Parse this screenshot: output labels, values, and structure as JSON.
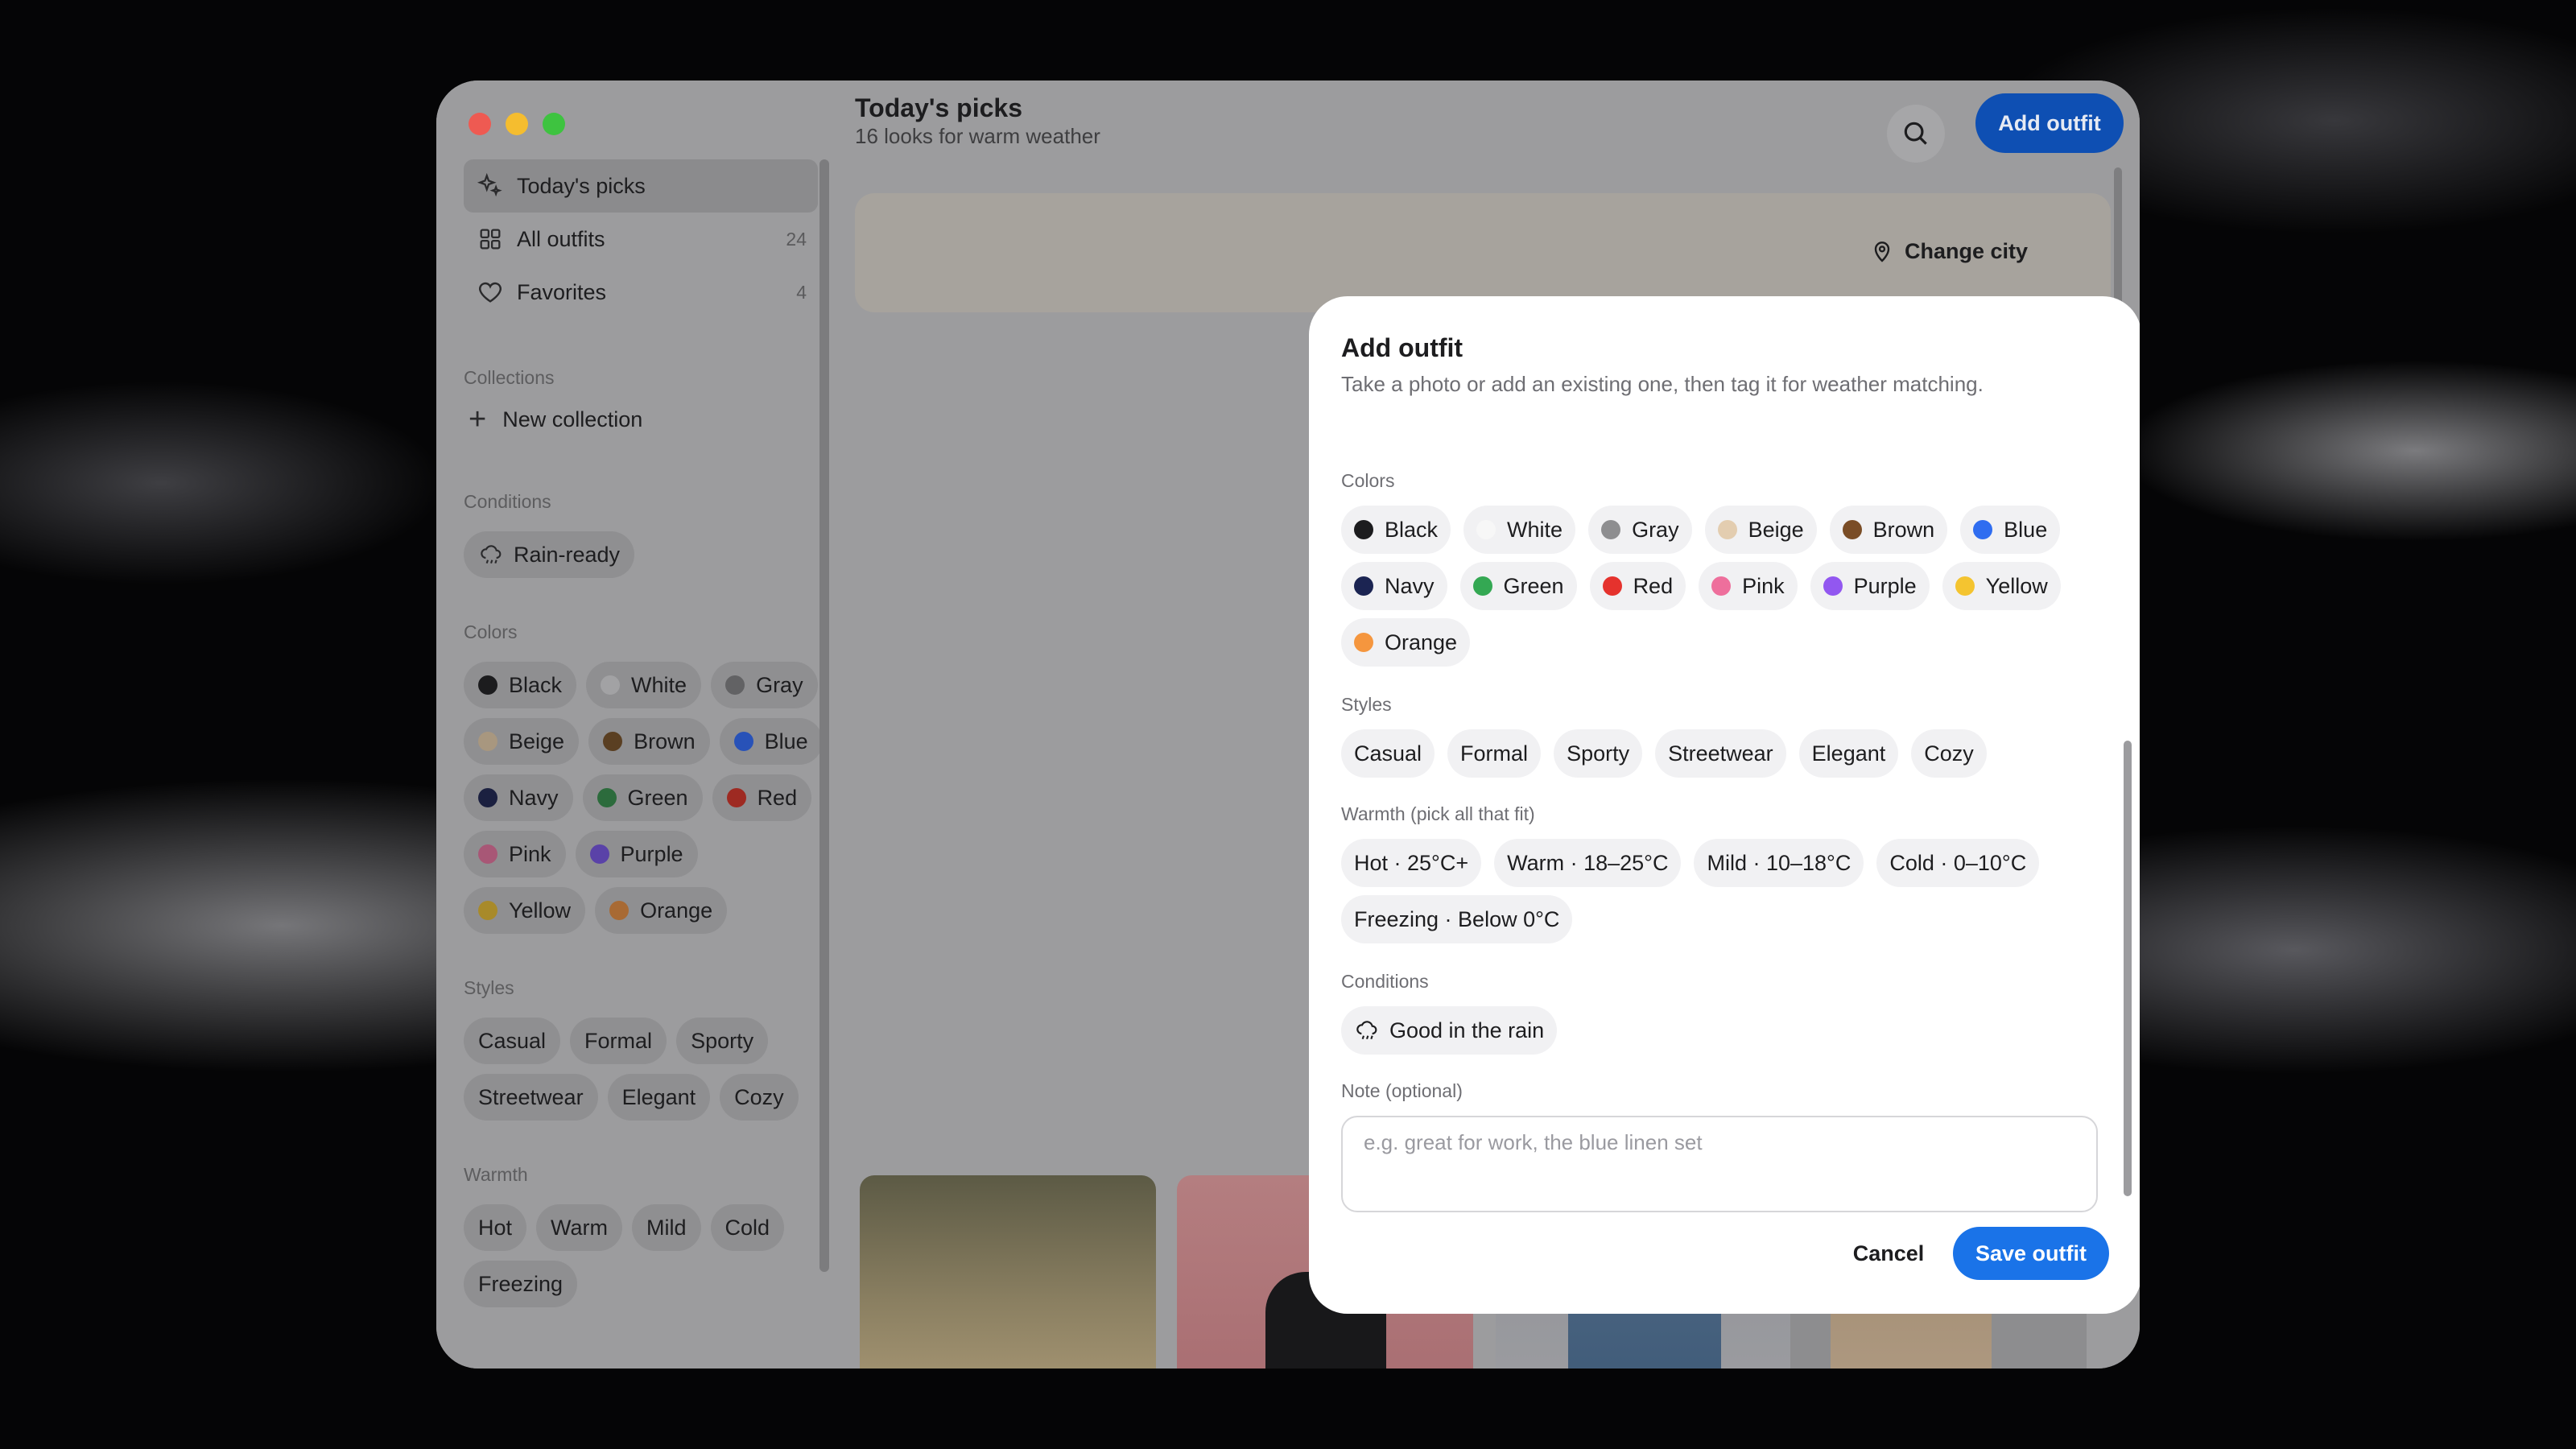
{
  "window": {
    "traffic_lights": {
      "close": "#ee5a52",
      "minimize": "#f5bd2f",
      "zoom": "#3ec340"
    }
  },
  "sidebar": {
    "nav": [
      {
        "label": "Today's picks",
        "icon": "sparkles-icon",
        "count": ""
      },
      {
        "label": "All outfits",
        "icon": "grid-icon",
        "count": "24"
      },
      {
        "label": "Favorites",
        "icon": "heart-icon",
        "count": "4"
      }
    ],
    "collections_heading": "Collections",
    "new_collection": "New collection",
    "conditions_heading": "Conditions",
    "conditions": [
      {
        "label": "Rain-ready",
        "icon": "rain-cloud-icon"
      }
    ],
    "colors_heading": "Colors",
    "colors": [
      {
        "label": "Black",
        "color": "#1c1c1e"
      },
      {
        "label": "White",
        "color": "#f2f2f2"
      },
      {
        "label": "Gray",
        "color": "#8e8e90"
      },
      {
        "label": "Beige",
        "color": "#d9c2a3"
      },
      {
        "label": "Brown",
        "color": "#7a4d26"
      },
      {
        "label": "Blue",
        "color": "#2f6df0"
      },
      {
        "label": "Navy",
        "color": "#1b2452"
      },
      {
        "label": "Green",
        "color": "#2f9a4c"
      },
      {
        "label": "Red",
        "color": "#e23a2e"
      },
      {
        "label": "Pink",
        "color": "#e96f9a"
      },
      {
        "label": "Purple",
        "color": "#8a5cf0"
      },
      {
        "label": "Yellow",
        "color": "#f2c62e"
      },
      {
        "label": "Orange",
        "color": "#f08a3a"
      }
    ],
    "styles_heading": "Styles",
    "styles": [
      "Casual",
      "Formal",
      "Sporty",
      "Streetwear",
      "Elegant",
      "Cozy"
    ],
    "warmth_heading": "Warmth",
    "warmth": [
      "Hot",
      "Warm",
      "Mild",
      "Cold",
      "Freezing"
    ]
  },
  "main": {
    "title": "Today's picks",
    "subtitle": "16 looks for warm weather",
    "search_icon": "search-icon",
    "add_button": "Add outfit",
    "change_city": "Change city",
    "change_city_icon": "map-pin-icon"
  },
  "modal": {
    "title": "Add outfit",
    "subtitle": "Take a photo or add an existing one, then tag it for weather matching.",
    "colors_heading": "Colors",
    "colors": [
      {
        "label": "Black",
        "color": "#1c1c1e"
      },
      {
        "label": "White",
        "color": "#f4f4f4"
      },
      {
        "label": "Gray",
        "color": "#8e8e90"
      },
      {
        "label": "Beige",
        "color": "#e3cdb0"
      },
      {
        "label": "Brown",
        "color": "#7a4d26"
      },
      {
        "label": "Blue",
        "color": "#2f6df0"
      },
      {
        "label": "Navy",
        "color": "#1b2452"
      },
      {
        "label": "Green",
        "color": "#34a853"
      },
      {
        "label": "Red",
        "color": "#e5322d"
      },
      {
        "label": "Pink",
        "color": "#ee6f9c"
      },
      {
        "label": "Purple",
        "color": "#9257f0"
      },
      {
        "label": "Yellow",
        "color": "#f4c430"
      },
      {
        "label": "Orange",
        "color": "#f5963e"
      }
    ],
    "styles_heading": "Styles",
    "styles": [
      "Casual",
      "Formal",
      "Sporty",
      "Streetwear",
      "Elegant",
      "Cozy"
    ],
    "warmth_heading": "Warmth (pick all that fit)",
    "warmth": [
      "Hot · 25°C+",
      "Warm · 18–25°C",
      "Mild · 10–18°C",
      "Cold · 0–10°C",
      "Freezing · Below 0°C"
    ],
    "conditions_heading": "Conditions",
    "conditions": [
      {
        "label": "Good in the rain",
        "icon": "rain-cloud-icon"
      }
    ],
    "note_heading": "Note (optional)",
    "note_placeholder": "e.g. great for work, the blue linen set",
    "note_value": "",
    "cancel_button": "Cancel",
    "save_button": "Save outfit",
    "accent_color": "#1a73e8"
  }
}
